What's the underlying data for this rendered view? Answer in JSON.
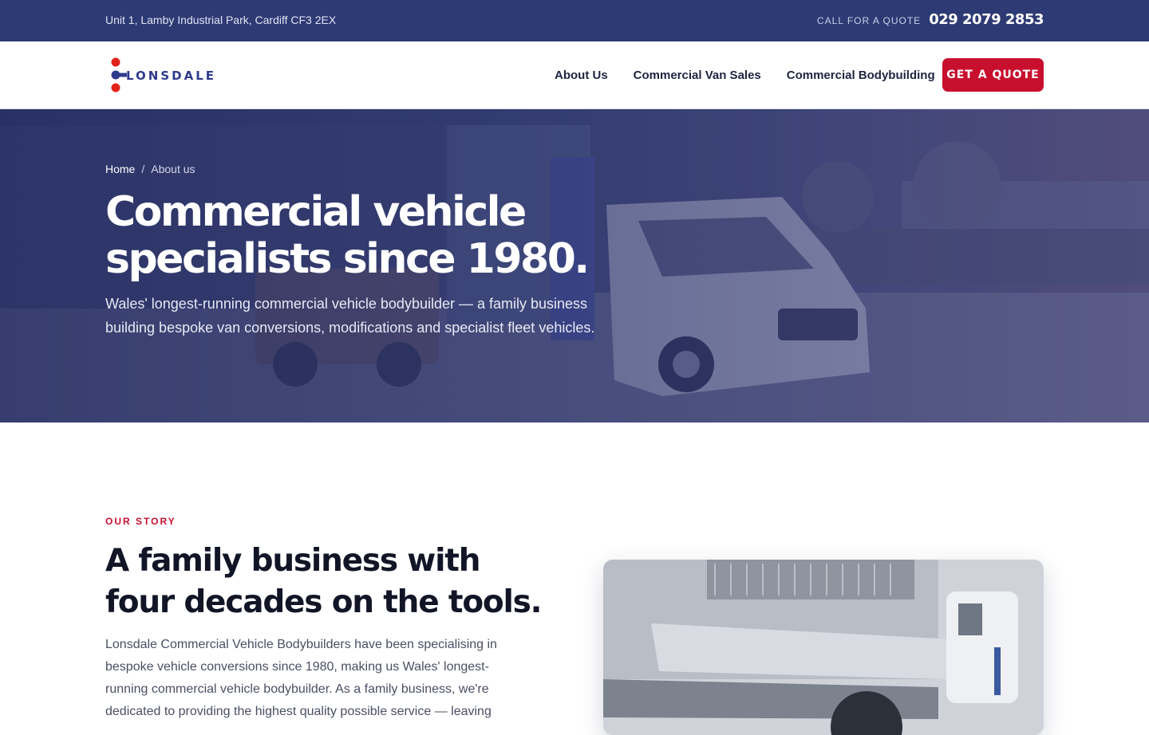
{
  "topbar": {
    "address": "Unit 1, Lamby Industrial Park, Cardiff CF3 2EX",
    "call_label": "CALL FOR A QUOTE",
    "phone": "029 2079 2853"
  },
  "nav": {
    "logo_text": "LONSDALE",
    "items": [
      {
        "label": "About Us"
      },
      {
        "label": "Commercial Van Sales"
      },
      {
        "label": "Commercial Bodybuilding"
      }
    ],
    "cta_label": "GET A QUOTE"
  },
  "hero": {
    "breadcrumb": {
      "home": "Home",
      "separator": "/",
      "current": "About us"
    },
    "title": "Commercial vehicle specialists since 1980.",
    "lede": "Wales' longest-running commercial vehicle bodybuilder — a family business building bespoke van conversions, modifications and specialist fleet vehicles."
  },
  "story": {
    "eyebrow": "OUR STORY",
    "title": "A family business with four decades on the tools.",
    "body": "Lonsdale Commercial Vehicle Bodybuilders have been specialising in bespoke vehicle conversions since 1980, making us Wales' longest-running commercial vehicle bodybuilder. As a family business, we're dedicated to providing the highest quality possible service — leaving"
  },
  "colors": {
    "topbar_bg": "#2e3a73",
    "brand_blue": "#2e3a8c",
    "accent_red": "#c8102e"
  },
  "icons": [
    "logo-dots-icon"
  ]
}
